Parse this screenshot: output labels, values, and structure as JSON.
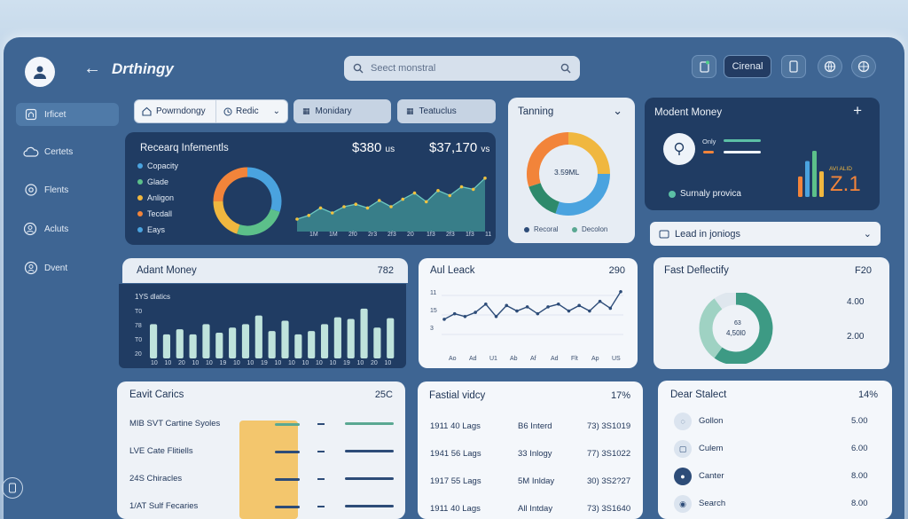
{
  "app": {
    "title": "Drthingy"
  },
  "search": {
    "placeholder": "Seect monstral"
  },
  "top": {
    "action_label": "Cirenal"
  },
  "nav": [
    {
      "label": "Irficet",
      "icon": "home-icon",
      "active": true
    },
    {
      "label": "Certets",
      "icon": "cloud-icon"
    },
    {
      "label": "Flents",
      "icon": "gear-icon"
    },
    {
      "label": "Acluts",
      "icon": "people-icon"
    },
    {
      "label": "Dvent",
      "icon": "user-icon"
    }
  ],
  "filters": [
    {
      "label": "Powrndongy"
    },
    {
      "label": "Redic"
    },
    {
      "label": "Monidary"
    },
    {
      "label": "Teatuclus"
    }
  ],
  "recent": {
    "title": "Recearq Infementls",
    "value1": "$380",
    "unit1": "us",
    "value2": "$37,170",
    "unit2": "vs",
    "legend": [
      "Copacity",
      "Glade",
      "Anligon",
      "Tecdall",
      "Eays"
    ],
    "legend_colors": [
      "#4aa3df",
      "#5cc08a",
      "#f0b73f",
      "#f2843a",
      "#4aa3df"
    ],
    "xticks": [
      "1M",
      "1M",
      "2f0",
      "2r3",
      "2f3",
      "20",
      "1f3",
      "2f3",
      "1f3",
      "11"
    ],
    "chart_data": {
      "type": "area",
      "values": [
        20,
        26,
        38,
        30,
        40,
        44,
        38,
        50,
        40,
        52,
        62,
        48,
        66,
        58,
        72,
        68,
        86
      ]
    },
    "donut": [
      {
        "value": 30,
        "color": "#4aa3df"
      },
      {
        "value": 25,
        "color": "#5cc08a"
      },
      {
        "value": 20,
        "color": "#f0b73f"
      },
      {
        "value": 25,
        "color": "#f2843a"
      }
    ]
  },
  "training": {
    "title": "Tanning",
    "center": "3.59ML",
    "legend": [
      "Recoral",
      "Decolon"
    ],
    "donut": [
      {
        "value": 25,
        "color": "#f0b73f"
      },
      {
        "value": 30,
        "color": "#4aa3df"
      },
      {
        "value": 15,
        "color": "#2e8a6b"
      },
      {
        "value": 30,
        "color": "#f2843a"
      }
    ]
  },
  "moment": {
    "title": "Modent Money",
    "only": "Only",
    "legend": "Surnaly provica",
    "big": "Z.1",
    "small": "AVI ALID",
    "bars": [
      {
        "value": 4,
        "color": "#f2843a"
      },
      {
        "value": 7,
        "color": "#4aa3df"
      },
      {
        "value": 9,
        "color": "#5cc08a"
      },
      {
        "value": 5,
        "color": "#f0b73f"
      }
    ]
  },
  "lead": {
    "label": "Lead in joniogs"
  },
  "adant": {
    "title": "Adant Money",
    "value": "782",
    "subtitle": "1YS dlatics",
    "yticks": [
      "T0",
      "78",
      "T0",
      "20"
    ],
    "xticks": [
      "10",
      "10",
      "20",
      "10",
      "10",
      "19",
      "10",
      "10",
      "19",
      "10",
      "10",
      "10",
      "10",
      "10",
      "19",
      "10",
      "20",
      "10"
    ],
    "chart_data": {
      "type": "bar",
      "values": [
        40,
        28,
        34,
        28,
        40,
        30,
        36,
        40,
        50,
        32,
        44,
        28,
        32,
        40,
        48,
        46,
        58,
        36,
        47
      ]
    }
  },
  "aul": {
    "title": "Aul Leack",
    "value": "290",
    "yticks": [
      "11",
      "15",
      "3"
    ],
    "xticks": [
      "Ao",
      "Ad",
      "U1",
      "Ab",
      "Af",
      "Ad",
      "Flt",
      "Ap",
      "US"
    ],
    "chart_data": {
      "type": "line",
      "values": [
        40,
        48,
        44,
        50,
        62,
        44,
        60,
        52,
        58,
        48,
        58,
        62,
        52,
        60,
        52,
        66,
        56,
        80
      ]
    }
  },
  "fast": {
    "title": "Fast Deflectify",
    "value": "F20",
    "center1": "63",
    "center2": "4,50l0",
    "tick1": "4.00",
    "tick2": "2.00",
    "donut": [
      {
        "value": 60,
        "color": "#3d9a84"
      },
      {
        "value": 30,
        "color": "#9fd2c3"
      },
      {
        "value": 10,
        "color": "#dfe7ee"
      }
    ]
  },
  "event": {
    "title": "Eavit Carics",
    "value": "25C",
    "rows": [
      "MIB SVT Cartine Syoles",
      "LVE Cate Flitiells",
      "24S Chiracles",
      "1/AT Sulf Fecaries"
    ],
    "bar_colors": [
      "#5aa892",
      "#2d4c78",
      "#2d4c78",
      "#2d4c78"
    ]
  },
  "festival": {
    "title": "Fastial vidcy",
    "value": "17%",
    "rows": [
      [
        "1911 40 Lags",
        "B6 Interd",
        "73) 3S1019"
      ],
      [
        "1941 56 Lags",
        "33 Inlogy",
        "77) 3S1022"
      ],
      [
        "1917 55 Lags",
        "5M Inlday",
        "30) 3S2?27"
      ],
      [
        "1911 40 Lags",
        "All Intday",
        "73) 3S1640"
      ]
    ]
  },
  "dear": {
    "title": "Dear Stalect",
    "value": "14%",
    "rows": [
      {
        "label": "Gollon",
        "value": "5.00",
        "icon": "chat-icon"
      },
      {
        "label": "Culem",
        "value": "6.00",
        "icon": "message-icon"
      },
      {
        "label": "Canter",
        "value": "8.00",
        "icon": "user-icon"
      },
      {
        "label": "Search",
        "value": "8.00",
        "icon": "search-icon"
      }
    ]
  }
}
